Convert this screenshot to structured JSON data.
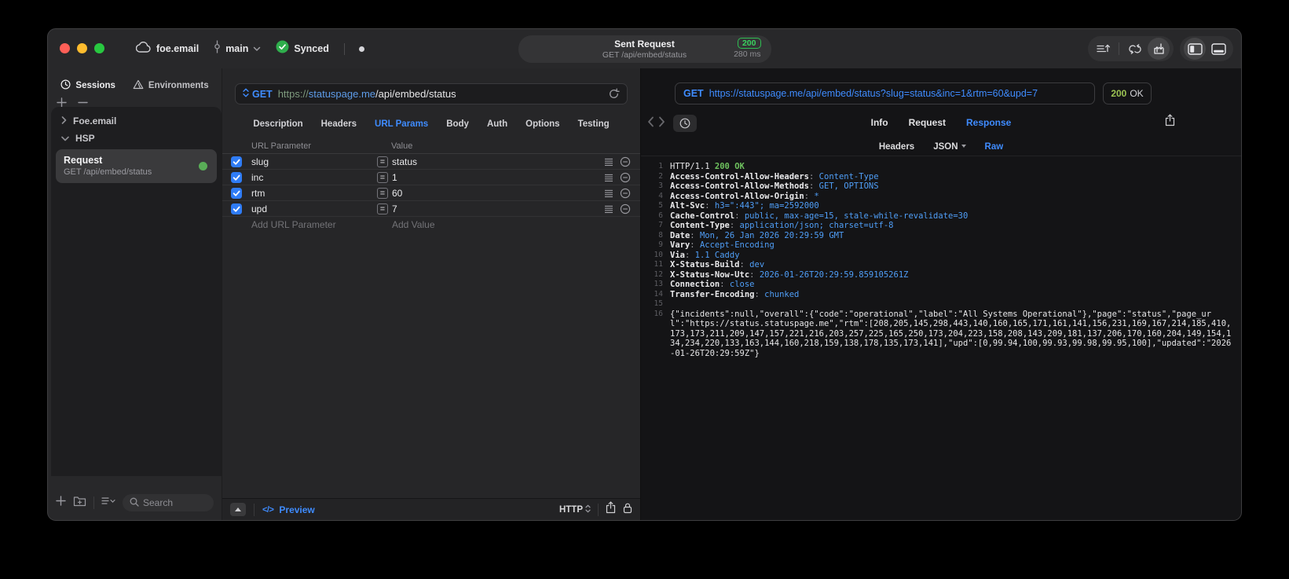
{
  "titlebar": {
    "project": "foe.email",
    "branch": "main",
    "sync_label": "Synced",
    "request_summary": {
      "title": "Sent Request",
      "method_path": "GET /api/embed/status",
      "status_code": "200",
      "duration": "280 ms"
    }
  },
  "sidebar": {
    "tabs": {
      "sessions": "Sessions",
      "environments": "Environments"
    },
    "tree": {
      "group1": "Foe.email",
      "group2": "HSP"
    },
    "request_item": {
      "title": "Request",
      "subtitle": "GET /api/embed/status"
    },
    "search_placeholder": "Search"
  },
  "request_editor": {
    "method": "GET",
    "url": {
      "scheme": "https://",
      "host": "statuspage.me",
      "path": "/api/embed/status"
    },
    "tabs": [
      "Description",
      "Headers",
      "URL Params",
      "Body",
      "Auth",
      "Options",
      "Testing"
    ],
    "active_tab": "URL Params",
    "params_table": {
      "columns": [
        "URL Parameter",
        "Value"
      ],
      "rows": [
        {
          "name": "slug",
          "value": "status",
          "checked": true
        },
        {
          "name": "inc",
          "value": "1",
          "checked": true
        },
        {
          "name": "rtm",
          "value": "60",
          "checked": true
        },
        {
          "name": "upd",
          "value": "7",
          "checked": true
        }
      ],
      "add_parameter_placeholder": "Add URL Parameter",
      "add_value_placeholder": "Add Value"
    },
    "footer": {
      "preview": "Preview",
      "code_glyph": "</>",
      "protocol": "HTTP"
    }
  },
  "response_viewer": {
    "request_line": {
      "method": "GET",
      "url": "https://statuspage.me/api/embed/status?slug=status&inc=1&rtm=60&upd=7"
    },
    "status": {
      "code": "200",
      "text": "OK"
    },
    "tabs": [
      "Info",
      "Request",
      "Response"
    ],
    "active_tab": "Response",
    "subtabs": [
      "Headers",
      "JSON",
      "Raw"
    ],
    "active_subtab": "Raw",
    "raw_lines": [
      {
        "n": "1",
        "parts": [
          {
            "t": "HTTP/1.1 ",
            "c": "plain"
          },
          {
            "t": "200 OK",
            "c": "status"
          }
        ]
      },
      {
        "n": "2",
        "parts": [
          {
            "t": "Access-Control-Allow-Headers",
            "c": "key"
          },
          {
            "t": ": ",
            "c": "sep"
          },
          {
            "t": "Content-Type",
            "c": "val"
          }
        ]
      },
      {
        "n": "3",
        "parts": [
          {
            "t": "Access-Control-Allow-Methods",
            "c": "key"
          },
          {
            "t": ": ",
            "c": "sep"
          },
          {
            "t": "GET, OPTIONS",
            "c": "val"
          }
        ]
      },
      {
        "n": "4",
        "parts": [
          {
            "t": "Access-Control-Allow-Origin",
            "c": "key"
          },
          {
            "t": ": ",
            "c": "sep"
          },
          {
            "t": "*",
            "c": "val"
          }
        ]
      },
      {
        "n": "5",
        "parts": [
          {
            "t": "Alt-Svc",
            "c": "key"
          },
          {
            "t": ": ",
            "c": "sep"
          },
          {
            "t": "h3=\":443\"; ma=2592000",
            "c": "val"
          }
        ]
      },
      {
        "n": "6",
        "parts": [
          {
            "t": "Cache-Control",
            "c": "key"
          },
          {
            "t": ": ",
            "c": "sep"
          },
          {
            "t": "public, max-age=15, stale-while-revalidate=30",
            "c": "val"
          }
        ]
      },
      {
        "n": "7",
        "parts": [
          {
            "t": "Content-Type",
            "c": "key"
          },
          {
            "t": ": ",
            "c": "sep"
          },
          {
            "t": "application/json; charset=utf-8",
            "c": "val"
          }
        ]
      },
      {
        "n": "8",
        "parts": [
          {
            "t": "Date",
            "c": "key"
          },
          {
            "t": ": ",
            "c": "sep"
          },
          {
            "t": "Mon, 26 Jan 2026 20:29:59 GMT",
            "c": "val"
          }
        ]
      },
      {
        "n": "9",
        "parts": [
          {
            "t": "Vary",
            "c": "key"
          },
          {
            "t": ": ",
            "c": "sep"
          },
          {
            "t": "Accept-Encoding",
            "c": "val"
          }
        ]
      },
      {
        "n": "10",
        "parts": [
          {
            "t": "Via",
            "c": "key"
          },
          {
            "t": ": ",
            "c": "sep"
          },
          {
            "t": "1.1 Caddy",
            "c": "val"
          }
        ]
      },
      {
        "n": "11",
        "parts": [
          {
            "t": "X-Status-Build",
            "c": "key"
          },
          {
            "t": ": ",
            "c": "sep"
          },
          {
            "t": "dev",
            "c": "val"
          }
        ]
      },
      {
        "n": "12",
        "parts": [
          {
            "t": "X-Status-Now-Utc",
            "c": "key"
          },
          {
            "t": ": ",
            "c": "sep"
          },
          {
            "t": "2026-01-26T20:29:59.859105261Z",
            "c": "val"
          }
        ]
      },
      {
        "n": "13",
        "parts": [
          {
            "t": "Connection",
            "c": "key"
          },
          {
            "t": ": ",
            "c": "sep"
          },
          {
            "t": "close",
            "c": "val"
          }
        ]
      },
      {
        "n": "14",
        "parts": [
          {
            "t": "Transfer-Encoding",
            "c": "key"
          },
          {
            "t": ": ",
            "c": "sep"
          },
          {
            "t": "chunked",
            "c": "val"
          }
        ]
      },
      {
        "n": "15",
        "parts": []
      },
      {
        "n": "16",
        "parts": [
          {
            "t": "{\"incidents\":null,\"overall\":{\"code\":\"operational\",\"label\":\"All Systems Operational\"},\"page\":\"status\",\"page_url\":\"https://status.statuspage.me\",\"rtm\":[208,205,145,298,443,140,160,165,171,161,141,156,231,169,167,214,185,410,173,173,211,209,147,157,221,216,203,257,225,165,250,173,204,223,158,208,143,209,181,137,206,170,160,204,149,154,134,234,220,133,163,144,160,218,159,138,178,135,173,141],\"upd\":[0,99.94,100,99.93,99.98,99.95,100],\"updated\":\"2026-01-26T20:29:59Z\"}",
            "c": "plain"
          }
        ]
      }
    ]
  },
  "colors": {
    "accent_blue": "#3f8cff",
    "status_green_badge": "#3ad15f",
    "response_status_green": "#9cc353",
    "header_value_blue": "#4f9ef7",
    "checkbox_blue": "#2f7cf6"
  }
}
